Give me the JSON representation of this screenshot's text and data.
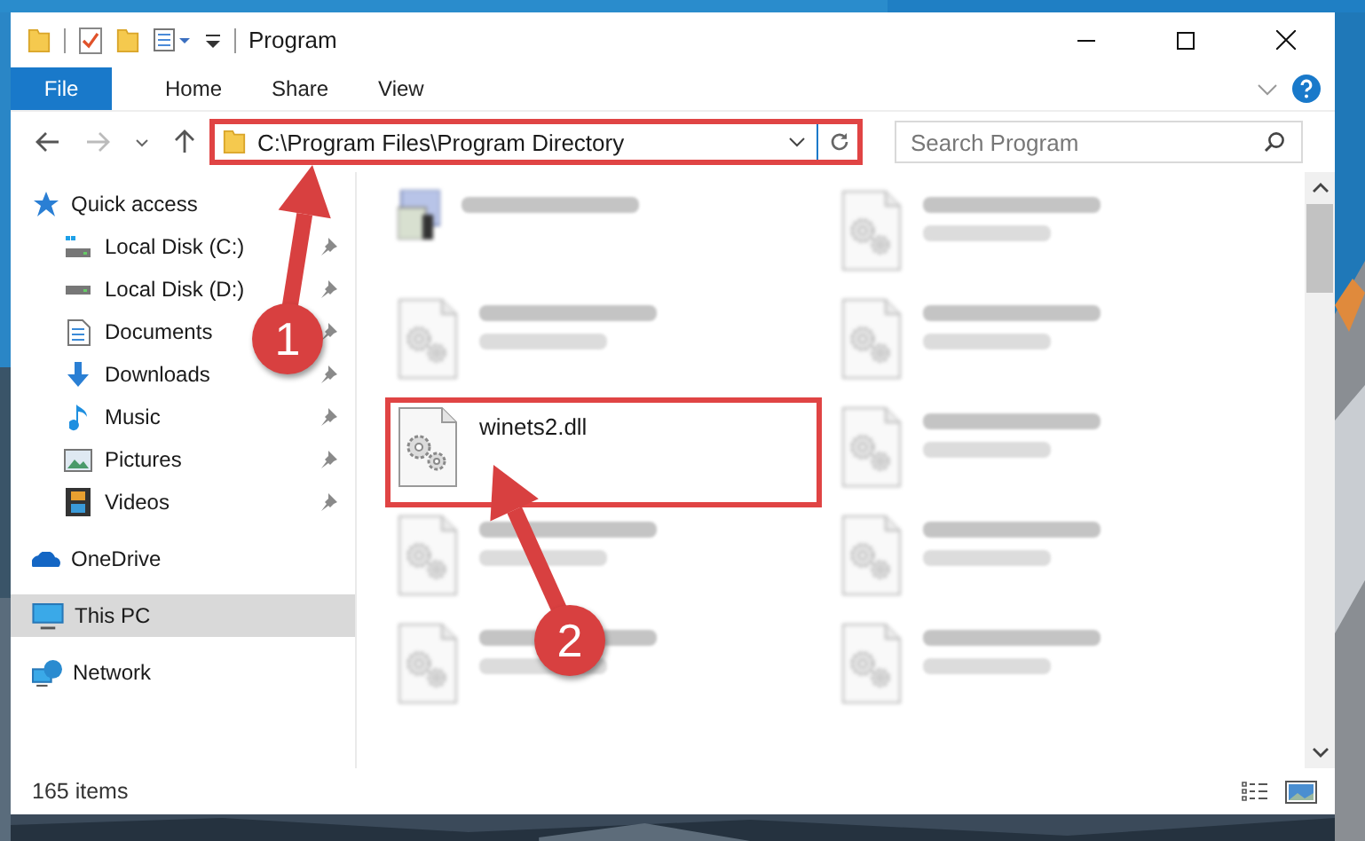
{
  "window": {
    "title": "Program"
  },
  "ribbon": {
    "tabs": [
      {
        "label": "File",
        "selected": true
      },
      {
        "label": "Home",
        "selected": false
      },
      {
        "label": "Share",
        "selected": false
      },
      {
        "label": "View",
        "selected": false
      }
    ]
  },
  "address_bar": {
    "path": "C:\\Program Files\\Program Directory",
    "highlighted": true
  },
  "search": {
    "placeholder": "Search Program"
  },
  "sidebar": {
    "items": [
      {
        "label": "Quick access",
        "kind": "star",
        "selected": false,
        "children": [
          {
            "label": "Local Disk (C:)",
            "kind": "drive-c",
            "pinned": true,
            "selected": false
          },
          {
            "label": "Local Disk (D:)",
            "kind": "drive",
            "pinned": true,
            "selected": false
          },
          {
            "label": "Documents",
            "kind": "document",
            "pinned": true,
            "selected": false
          },
          {
            "label": "Downloads",
            "kind": "download",
            "pinned": true,
            "selected": false
          },
          {
            "label": "Music",
            "kind": "music",
            "pinned": true,
            "selected": false
          },
          {
            "label": "Pictures",
            "kind": "picture",
            "pinned": true,
            "selected": false
          },
          {
            "label": "Videos",
            "kind": "video",
            "pinned": true,
            "selected": false
          }
        ]
      },
      {
        "label": "OneDrive",
        "kind": "cloud",
        "selected": false
      },
      {
        "label": "This PC",
        "kind": "pc",
        "selected": true
      },
      {
        "label": "Network",
        "kind": "network",
        "selected": false
      }
    ]
  },
  "files": [
    {
      "kind": "exe",
      "blurred": true,
      "highlighted": false
    },
    {
      "kind": "dll",
      "blurred": true,
      "highlighted": false
    },
    {
      "kind": "dll",
      "blurred": true,
      "highlighted": false
    },
    {
      "kind": "dll",
      "blurred": true,
      "highlighted": false
    },
    {
      "name": "winets2.dll",
      "kind": "dll",
      "blurred": false,
      "highlighted": true
    },
    {
      "kind": "dll",
      "blurred": true,
      "highlighted": false
    },
    {
      "kind": "dll",
      "blurred": true,
      "highlighted": false
    },
    {
      "kind": "dll",
      "blurred": true,
      "highlighted": false
    },
    {
      "kind": "dll",
      "blurred": true,
      "highlighted": false
    },
    {
      "kind": "dll",
      "blurred": true,
      "highlighted": false
    }
  ],
  "status_bar": {
    "count": "165 items"
  },
  "annotations": [
    {
      "number": "1"
    },
    {
      "number": "2"
    }
  ]
}
